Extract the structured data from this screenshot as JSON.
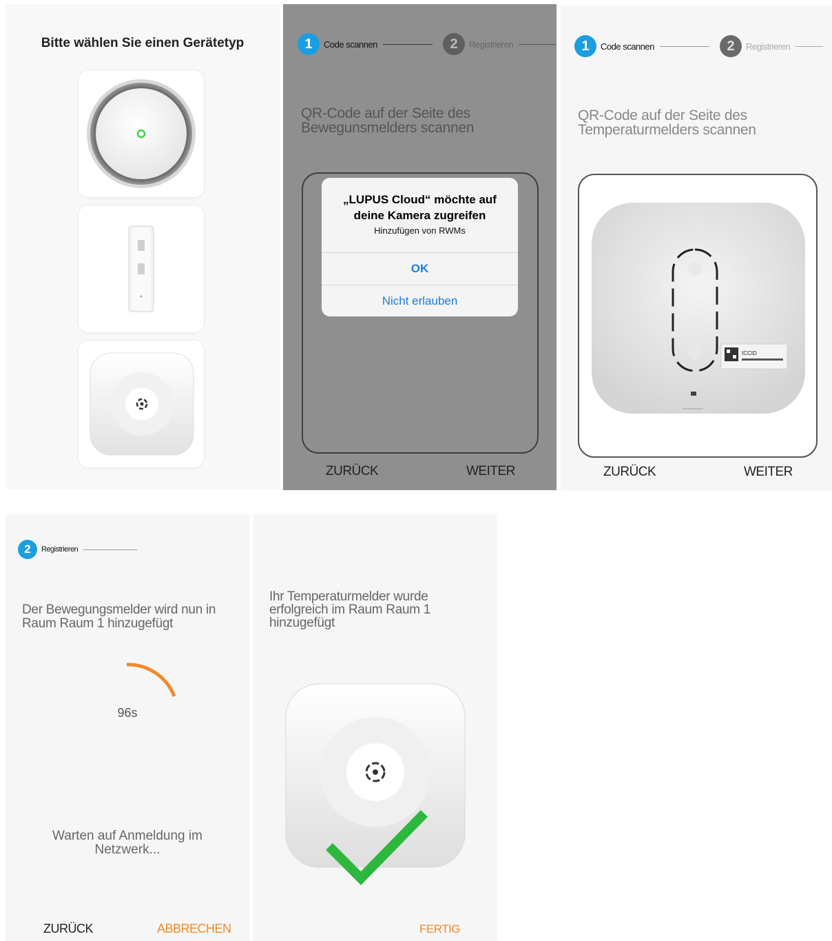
{
  "colors": {
    "accent_blue": "#1a9ee0",
    "step_inactive": "#5f5f5f",
    "orange": "#f08a2e",
    "alert_blue": "#1a7de0",
    "check_green": "#2db83d",
    "led_green": "#38d64a"
  },
  "screen1": {
    "title": "Bitte wählen Sie einen Gerätetyp",
    "device_types": [
      {
        "icon": "smoke-detector-icon"
      },
      {
        "icon": "motion-detector-icon"
      },
      {
        "icon": "temperature-sensor-icon"
      }
    ]
  },
  "screen2": {
    "steps": [
      {
        "number": "1",
        "label": "Code scannen",
        "active": true
      },
      {
        "number": "2",
        "label": "Registrieren",
        "active": false
      }
    ],
    "heading_line1": "QR-Code auf der Seite des",
    "heading_line2": "Bewegunsmelders scannen",
    "alert": {
      "title": "„LUPUS Cloud“ möchte auf deine Kamera zugreifen",
      "message": "Hinzufügen von RWMs",
      "ok": "OK",
      "deny": "Nicht erlauben"
    },
    "back": "ZURÜCK",
    "next": "WEITER"
  },
  "screen3": {
    "steps": [
      {
        "number": "1",
        "label": "Code scannen",
        "active": true
      },
      {
        "number": "2",
        "label": "Registrieren",
        "active": false
      }
    ],
    "heading_line1": "QR-Code auf der Seite des",
    "heading_line2": "Temperaturmelders scannen",
    "qr_label": "ICCID",
    "back": "ZURÜCK",
    "next": "WEITER"
  },
  "screen4": {
    "step": {
      "number": "2",
      "label": "Registrieren"
    },
    "heading_line1": "Der Bewegungsmelder wird nun in",
    "heading_line2": "Raum Raum 1 hinzugefügt",
    "countdown": "96s",
    "wait_line1": "Warten auf Anmeldung im",
    "wait_line2": "Netzwerk...",
    "back": "ZURÜCK",
    "cancel": "ABBRECHEN"
  },
  "screen5": {
    "msg_line1": "Ihr Temperaturmelder wurde",
    "msg_line2": "erfolgreich im Raum Raum 1",
    "msg_line3": "hinzugefügt",
    "done": "FERTIG"
  }
}
